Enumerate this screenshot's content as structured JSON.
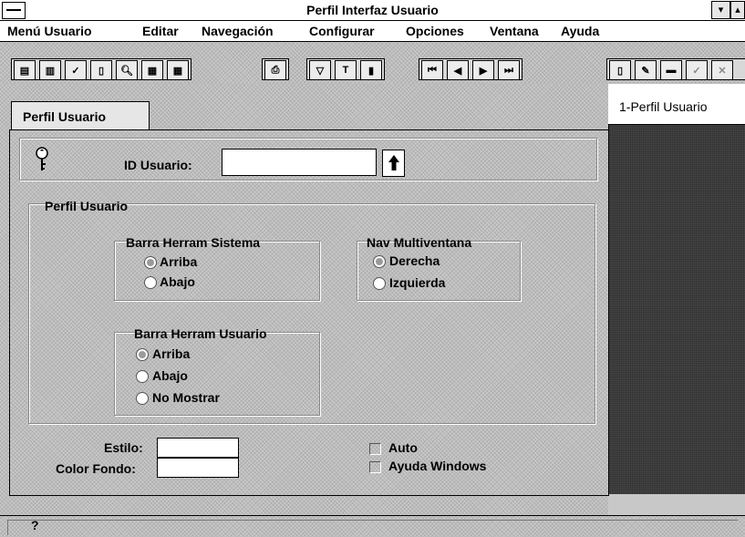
{
  "window": {
    "title": "Perfil Interfaz Usuario",
    "btn_min": "▾",
    "btn_max": "▴"
  },
  "menu": [
    "Menú Usuario",
    "Editar",
    "Navegación",
    "Configurar",
    "Opciones",
    "Ventana",
    "Ayuda"
  ],
  "toolbar": {
    "group1": [
      "copy-icon",
      "paste-icon",
      "check-query-icon",
      "doc-icon",
      "search-icon",
      "grid-icon",
      "table-icon"
    ],
    "group2": [
      "print-icon"
    ],
    "group3": [
      "filter-icon",
      "text-icon",
      "chart-icon"
    ],
    "group4": [
      "first-icon",
      "prev-icon",
      "next-icon",
      "last-icon"
    ],
    "group5": [
      "new-icon",
      "edit-icon",
      "minus-icon",
      "ok-icon",
      "cancel-icon"
    ]
  },
  "tab": {
    "label": "Perfil Usuario"
  },
  "right_panel": {
    "item": "1-Perfil Usuario"
  },
  "form": {
    "id_label": "ID Usuario:",
    "id_value": "",
    "perfil_label": "Perfil Usuario",
    "sys_toolbar": {
      "label": "Barra Herram Sistema",
      "options": [
        "Arriba",
        "Abajo"
      ],
      "selected": "Arriba"
    },
    "nav": {
      "label": "Nav Multiventana",
      "options": [
        "Derecha",
        "Izquierda"
      ],
      "selected": "Derecha"
    },
    "user_toolbar": {
      "label": "Barra Herram Usuario",
      "options": [
        "Arriba",
        "Abajo",
        "No Mostrar"
      ],
      "selected": "Arriba"
    },
    "estilo_label": "Estilo:",
    "estilo_value": "",
    "color_label": "Color Fondo:",
    "color_value": "",
    "auto_label": "Auto",
    "auto_checked": false,
    "help_label": "Ayuda Windows",
    "help_checked": false
  },
  "status": {
    "text": "?"
  }
}
